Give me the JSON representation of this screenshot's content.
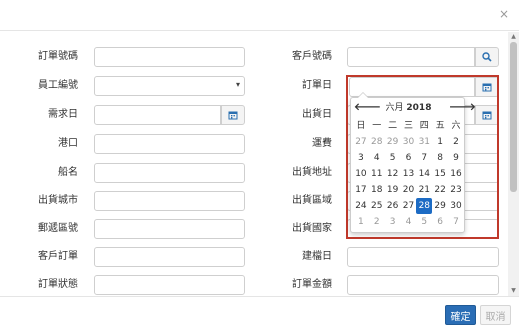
{
  "dialog": {
    "close_glyph": "×"
  },
  "labels": {
    "order_no": "訂單號碼",
    "employee_no": "員工編號",
    "demand_date": "需求日",
    "port": "港口",
    "vessel": "船名",
    "ship_city": "出貨城市",
    "postal_code": "郵遞區號",
    "customer_order": "客戶訂單",
    "order_status": "訂單狀態",
    "customer_no": "客戶號碼",
    "order_date": "訂單日",
    "ship_date": "出貨日",
    "freight": "運費",
    "ship_address": "出貨地址",
    "ship_region": "出貨區域",
    "ship_country": "出貨國家",
    "created_date": "建檔日",
    "order_amount": "訂單金額"
  },
  "icons": {
    "search": "search-icon",
    "calendar": "calendar-icon",
    "caret": "▾"
  },
  "datepicker": {
    "prev": "🡐",
    "next": "🡒",
    "month": "六月",
    "year": "2018",
    "weekdays": [
      "日",
      "一",
      "二",
      "三",
      "四",
      "五",
      "六"
    ],
    "weeks": [
      [
        {
          "d": "27",
          "m": true
        },
        {
          "d": "28",
          "m": true
        },
        {
          "d": "29",
          "m": true
        },
        {
          "d": "30",
          "m": true
        },
        {
          "d": "31",
          "m": true
        },
        {
          "d": "1"
        },
        {
          "d": "2"
        }
      ],
      [
        {
          "d": "3"
        },
        {
          "d": "4"
        },
        {
          "d": "5"
        },
        {
          "d": "6"
        },
        {
          "d": "7"
        },
        {
          "d": "8"
        },
        {
          "d": "9"
        }
      ],
      [
        {
          "d": "10"
        },
        {
          "d": "11"
        },
        {
          "d": "12"
        },
        {
          "d": "13"
        },
        {
          "d": "14"
        },
        {
          "d": "15"
        },
        {
          "d": "16"
        }
      ],
      [
        {
          "d": "17"
        },
        {
          "d": "18"
        },
        {
          "d": "19"
        },
        {
          "d": "20"
        },
        {
          "d": "21"
        },
        {
          "d": "22"
        },
        {
          "d": "23"
        }
      ],
      [
        {
          "d": "24"
        },
        {
          "d": "25"
        },
        {
          "d": "26"
        },
        {
          "d": "27"
        },
        {
          "d": "28",
          "a": true
        },
        {
          "d": "29"
        },
        {
          "d": "30"
        }
      ],
      [
        {
          "d": "1",
          "m": true
        },
        {
          "d": "2",
          "m": true
        },
        {
          "d": "3",
          "m": true
        },
        {
          "d": "4",
          "m": true
        },
        {
          "d": "5",
          "m": true
        },
        {
          "d": "6",
          "m": true
        },
        {
          "d": "7",
          "m": true
        }
      ]
    ]
  },
  "footer": {
    "ok_label": "確定",
    "cancel_label": "取消"
  },
  "colors": {
    "primary": "#2a6db5",
    "highlight_box": "#c0392b",
    "active_day": "#1c6bc4"
  }
}
